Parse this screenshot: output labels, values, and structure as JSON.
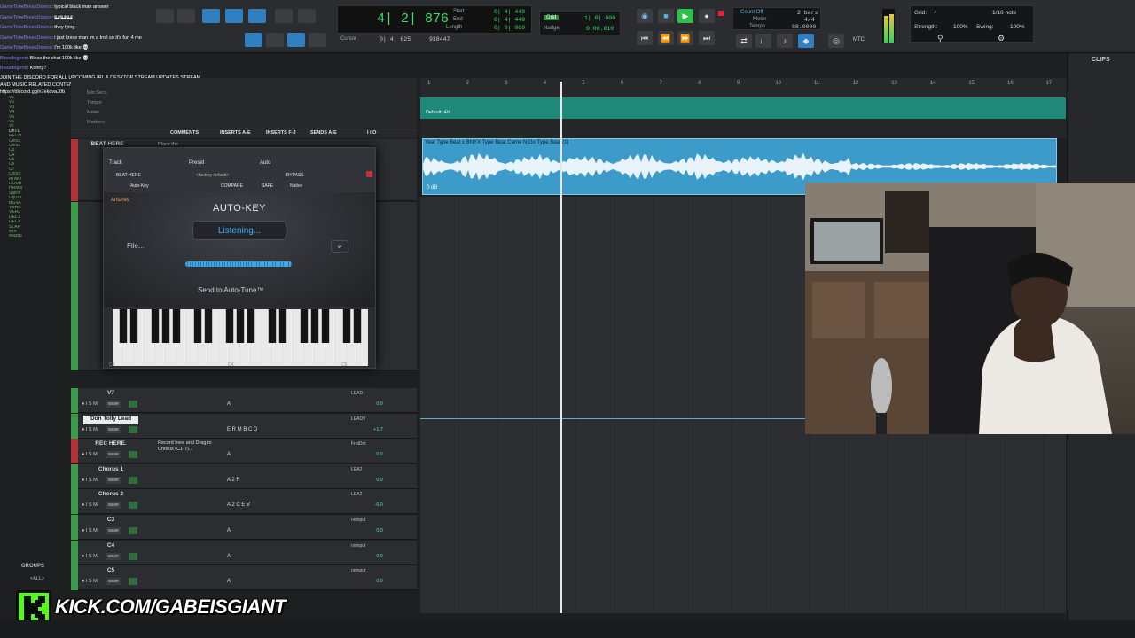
{
  "transport": {
    "main_counter": "4| 2| 876",
    "start_label": "Start",
    "start_val": "0| 4| 449",
    "end_label": "End",
    "end_val": "0| 4| 449",
    "length_label": "Length",
    "length_val": "0| 0| 000",
    "cursor_label": "Cursor",
    "cursor_val": "0| 4| 625",
    "cursor_extra": "938447",
    "grid_label": "Grid",
    "grid_val": "1| 0| 000",
    "nudge_label": "Nudge",
    "nudge_val": "0:00.010",
    "countoff_label": "Count Off",
    "countoff_val": "2 bars",
    "meter_label": "Meter",
    "meter_val": "4/4",
    "tempo_label": "Tempo",
    "tempo_val": "88.0000",
    "mtc_label": "MTC"
  },
  "grid_panel": {
    "grid_label": "Grid:",
    "grid_value": "1/16 note",
    "strength_label": "Strength:",
    "strength_value": "100%",
    "swing_label": "Swing:",
    "swing_value": "100%"
  },
  "chat": [
    {
      "user": "GameTimeBreakDowns",
      "msg": ": typical black man answer"
    },
    {
      "user": "GameTimeBreakDowns",
      "msg": ": 🎹🎹🎹"
    },
    {
      "user": "GameTimeBreakDowns",
      "msg": ": they lying"
    },
    {
      "user": "GameTimeBreakDowns",
      "msg": ": i just know man im a troll so it's fun 4 me"
    },
    {
      "user": "GameTimeBreakDowns",
      "msg": ": I'm 100k like 💀"
    },
    {
      "user": "Bloodlegend",
      "msg": ": Bless the chat 100k like 💀"
    },
    {
      "user": "Bloodlegend",
      "msg": ": Konny?"
    },
    {
      "user": "",
      "msg": "JOIN THE DISCORD FOR ALL UPCOMING IRL & DESKTOP STREAM UPDATES STREAM AND MUSIC RELATED CONTENT"
    },
    {
      "user": "",
      "msg": "https://discord.gg/n7ekdvaJ0b"
    }
  ],
  "tracklist": [
    "V1",
    "V2",
    "V3",
    "V4",
    "V5",
    "V6",
    "V7",
    "DnTL",
    "RECH",
    "Chrs1",
    "Chrs2",
    "C3",
    "C4",
    "C5",
    "C6",
    "C7",
    "ChrsV",
    "ATMO",
    "DOUB",
    "HRMN",
    "SlpPn",
    "DlyTnr",
    "BGVA",
    "VERB",
    "VER2",
    "DEL1",
    "DEL2",
    "SLAP",
    "MIX",
    "Mastr1"
  ],
  "groups_label": "GROUPS",
  "groups_all": "<ALL>",
  "ruler_left": [
    "Min:Secs",
    "Tempo",
    "Meter",
    "Markers"
  ],
  "columns": {
    "comments": "COMMENTS",
    "inserts_ae": "INSERTS A-E",
    "inserts_fj": "INSERTS F-J",
    "sends_ae": "SENDS A-E",
    "io": "I / O"
  },
  "tracks": [
    {
      "name": "V7",
      "hi": false,
      "comment": "",
      "ins": "A",
      "io": "LEAD",
      "val": "0.0"
    },
    {
      "name": "Don Tolly Lead",
      "hi": true,
      "comment": "",
      "ins": "E R M B C D",
      "io": "LEADV",
      "val": "+1.7"
    },
    {
      "name": "REC HERE.",
      "hi": false,
      "comment": "Record here and Drag to Chorus (C1-7)...",
      "ins": "A",
      "io": "FrntDnt",
      "val": "0.0"
    },
    {
      "name": "Chorus 1",
      "hi": false,
      "comment": "",
      "ins": "A 2 R",
      "io": "LEA2",
      "val": "0.0"
    },
    {
      "name": "Chorus 2",
      "hi": false,
      "comment": "",
      "ins": "A 2 C E V",
      "io": "LEA2",
      "val": "-6.0"
    },
    {
      "name": "C3",
      "hi": false,
      "comment": "",
      "ins": "A",
      "io": "noinput",
      "val": "0.0"
    },
    {
      "name": "C4",
      "hi": false,
      "comment": "",
      "ins": "A",
      "io": "noinput",
      "val": "0.0"
    },
    {
      "name": "C5",
      "hi": false,
      "comment": "",
      "ins": "A",
      "io": "noinput",
      "val": "0.0"
    }
  ],
  "track_first_name": "BEAT HERE",
  "track_first_comment": "Place the",
  "plugin": {
    "track_label": "Track",
    "preset_label": "Preset",
    "auto_label": "Auto",
    "track_value": "BEAT HERE",
    "preset_value": "<factory default>",
    "subtrack": "Auto-Key",
    "compare": "COMPARE",
    "safe": "SAFE",
    "bypass": "BYPASS",
    "native": "Native",
    "brand": "Antares",
    "title": "AUTO-KEY",
    "status": "Listening...",
    "file_btn": "File...",
    "send_btn": "Send to Auto-Tune™",
    "key_c3": "C3",
    "key_c4": "C4",
    "key_c5": "C5"
  },
  "timeline": {
    "bars": [
      "1",
      "2",
      "3",
      "4",
      "5",
      "6",
      "7",
      "8",
      "9",
      "10",
      "11",
      "12",
      "13",
      "14",
      "15",
      "16",
      "17"
    ],
    "tempo_default": "Default: 4/4",
    "clip_title": "Yeat Type Beat x BNYX Type Beat  Come N Go Type Beat (1)",
    "clip_db": "0 dB"
  },
  "clips_panel_label": "CLIPS",
  "kick_text": "KICK.COM/GABEISGIANT",
  "colors": {
    "kick_green": "#53fc18",
    "clip_blue": "#3c9bc8",
    "tempo_teal": "#1f8878",
    "counter_green": "#38e06a",
    "accent_blue": "#2f7fc1"
  }
}
